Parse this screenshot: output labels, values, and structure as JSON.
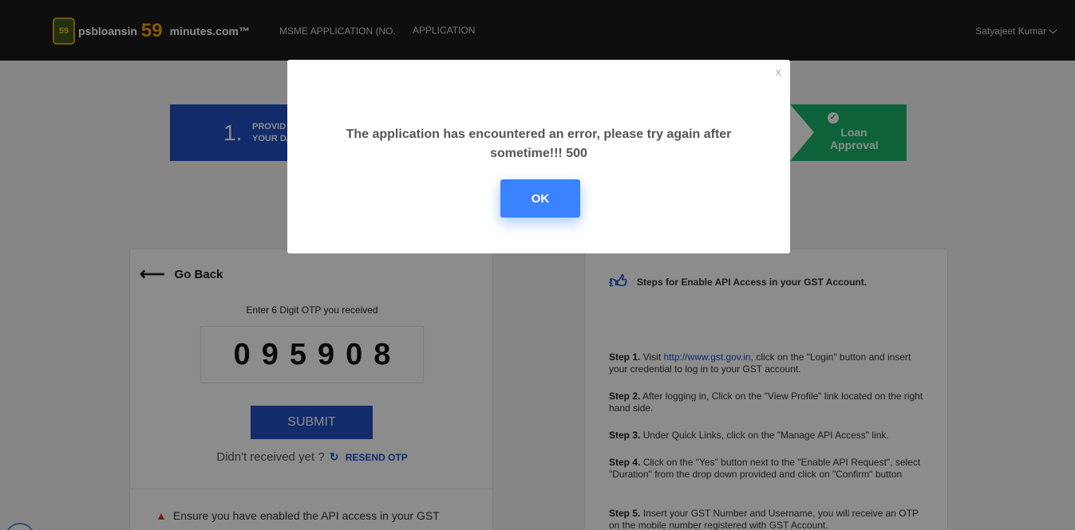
{
  "header": {
    "logo": {
      "badge_text": "59",
      "prefix": "psbloansin",
      "number": "59",
      "suffix": "minutes.com™"
    },
    "nav": [
      {
        "label": "MSME APPLICATION (NO."
      },
      {
        "label": "APPLICATION"
      }
    ],
    "user_name": "Satyajeet Kumar"
  },
  "steps_bar": {
    "first": {
      "number": "1.",
      "label_line1": "PROVID",
      "label_line2": "YOUR DA"
    },
    "last": {
      "label": "Loan Approval"
    }
  },
  "otp_card": {
    "go_back_label": "Go Back",
    "otp_prompt": "Enter 6 Digit OTP you received",
    "otp_value": "095908",
    "submit_label": "SUBMIT",
    "resend_prompt": "Didn't received yet ?",
    "resend_label": "RESEND OTP",
    "warning_text": "Ensure you have enabled the API access in your GST"
  },
  "instructions": {
    "heading": "Steps for Enable API Access in your GST Account.",
    "steps": [
      {
        "label": "Step 1.",
        "pre": "Visit",
        "link": "http://www.gst.gov.in",
        "text": ", click on the \"Login\" button and insert your credential to log in to your GST account."
      },
      {
        "label": "Step 2.",
        "text": "After logging in, Click on the \"View Profile\" link located on the right hand side."
      },
      {
        "label": "Step 3.",
        "text": "Under Quick Links, click on the \"Manage API Access\" link."
      },
      {
        "label": "Step 4.",
        "text": "Click on the \"Yes\" button next to the \"Enable API Request\", select \"Duration\" from the drop down provided and click on \"Confirm\" button"
      },
      {
        "label": "Step 5.",
        "text": "Insert your GST Number and Username, you will receive an OTP on the mobile number registered with GST Account."
      }
    ]
  },
  "modal": {
    "close_label": "x",
    "message": "The application has encountered an error, please try again after sometime!!! 500",
    "ok_label": "OK"
  },
  "colors": {
    "primary_blue": "#1f4fc4",
    "ok_button": "#3b82ff",
    "success_green": "#18b36b",
    "header_bg": "#1b1b1b",
    "logo_accent": "#f0a500"
  },
  "icons": [
    "arrow-left-icon",
    "refresh-icon",
    "warning-icon",
    "thumbs-up-icon",
    "chevron-down-icon",
    "check-circle-icon",
    "logo-badge-icon"
  ]
}
